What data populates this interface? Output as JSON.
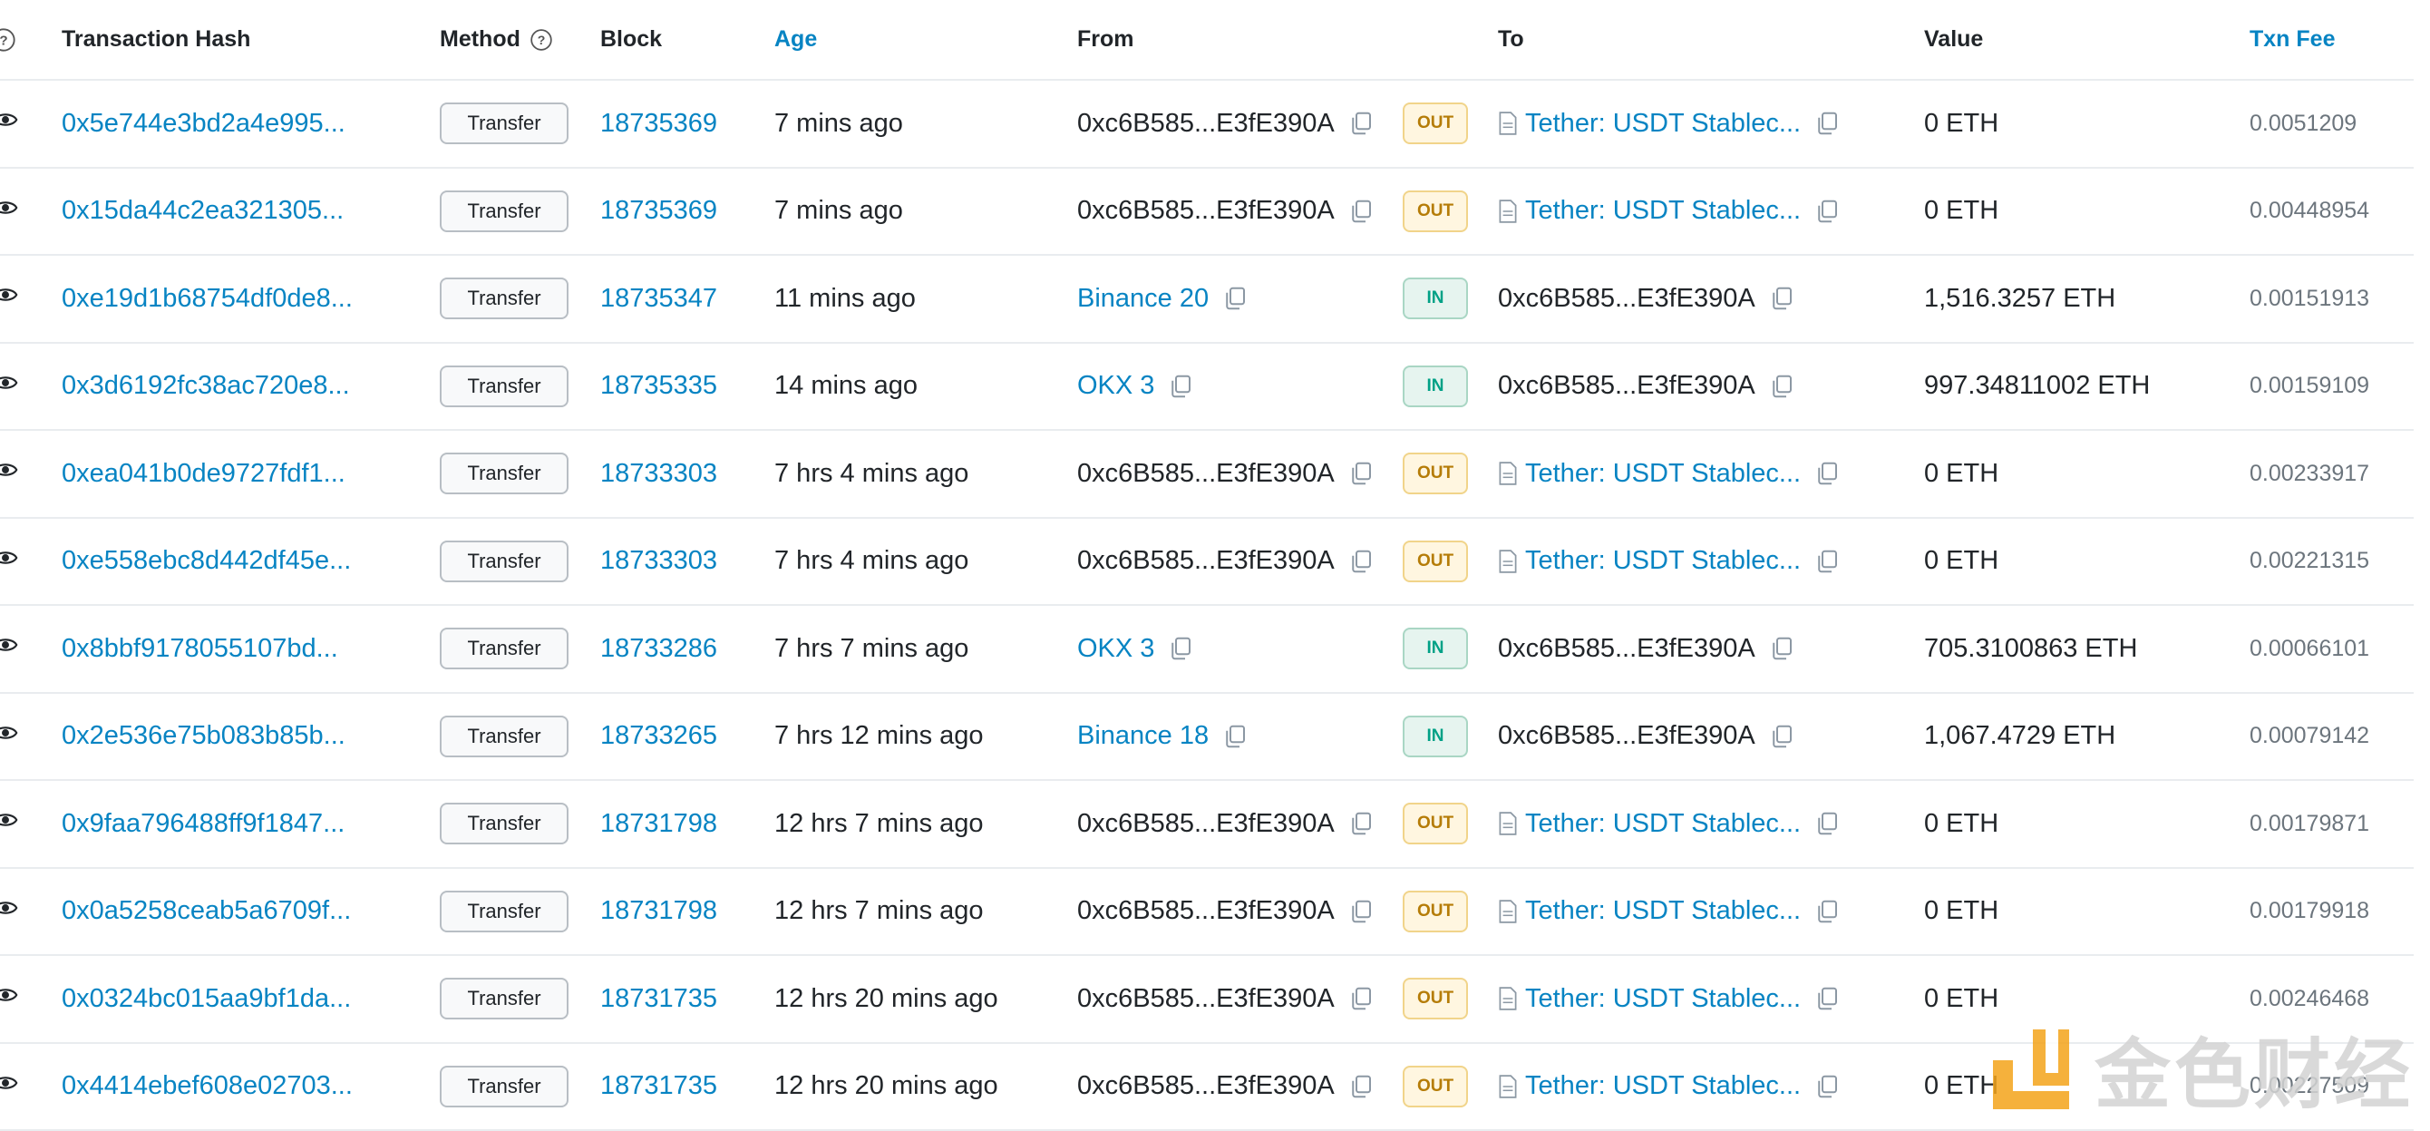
{
  "headers": {
    "hash": "Transaction Hash",
    "method": "Method",
    "block": "Block",
    "age": "Age",
    "from": "From",
    "to": "To",
    "value": "Value",
    "fee": "Txn Fee"
  },
  "colors": {
    "link": "#0784c3",
    "out_bg": "#fff6e0",
    "out_text": "#b57c07",
    "in_bg": "#e6f4ef",
    "in_text": "#00a186"
  },
  "rows": [
    {
      "hash": "0x5e744e3bd2a4e995...",
      "method": "Transfer",
      "block": "18735369",
      "age": "7 mins ago",
      "from": "0xc6B585...E3fE390A",
      "from_is_link": false,
      "direction": "OUT",
      "to": "Tether: USDT Stablec...",
      "to_is_contract": true,
      "value": "0 ETH",
      "fee": "0.0051209"
    },
    {
      "hash": "0x15da44c2ea321305...",
      "method": "Transfer",
      "block": "18735369",
      "age": "7 mins ago",
      "from": "0xc6B585...E3fE390A",
      "from_is_link": false,
      "direction": "OUT",
      "to": "Tether: USDT Stablec...",
      "to_is_contract": true,
      "value": "0 ETH",
      "fee": "0.00448954"
    },
    {
      "hash": "0xe19d1b68754df0de8...",
      "method": "Transfer",
      "block": "18735347",
      "age": "11 mins ago",
      "from": "Binance 20",
      "from_is_link": true,
      "direction": "IN",
      "to": "0xc6B585...E3fE390A",
      "to_is_contract": false,
      "value": "1,516.3257 ETH",
      "fee": "0.00151913"
    },
    {
      "hash": "0x3d6192fc38ac720e8...",
      "method": "Transfer",
      "block": "18735335",
      "age": "14 mins ago",
      "from": "OKX 3",
      "from_is_link": true,
      "direction": "IN",
      "to": "0xc6B585...E3fE390A",
      "to_is_contract": false,
      "value": "997.34811002 ETH",
      "fee": "0.00159109"
    },
    {
      "hash": "0xea041b0de9727fdf1...",
      "method": "Transfer",
      "block": "18733303",
      "age": "7 hrs 4 mins ago",
      "from": "0xc6B585...E3fE390A",
      "from_is_link": false,
      "direction": "OUT",
      "to": "Tether: USDT Stablec...",
      "to_is_contract": true,
      "value": "0 ETH",
      "fee": "0.00233917"
    },
    {
      "hash": "0xe558ebc8d442df45e...",
      "method": "Transfer",
      "block": "18733303",
      "age": "7 hrs 4 mins ago",
      "from": "0xc6B585...E3fE390A",
      "from_is_link": false,
      "direction": "OUT",
      "to": "Tether: USDT Stablec...",
      "to_is_contract": true,
      "value": "0 ETH",
      "fee": "0.00221315"
    },
    {
      "hash": "0x8bbf9178055107bd...",
      "method": "Transfer",
      "block": "18733286",
      "age": "7 hrs 7 mins ago",
      "from": "OKX 3",
      "from_is_link": true,
      "direction": "IN",
      "to": "0xc6B585...E3fE390A",
      "to_is_contract": false,
      "value": "705.3100863 ETH",
      "fee": "0.00066101"
    },
    {
      "hash": "0x2e536e75b083b85b...",
      "method": "Transfer",
      "block": "18733265",
      "age": "7 hrs 12 mins ago",
      "from": "Binance 18",
      "from_is_link": true,
      "direction": "IN",
      "to": "0xc6B585...E3fE390A",
      "to_is_contract": false,
      "value": "1,067.4729 ETH",
      "fee": "0.00079142"
    },
    {
      "hash": "0x9faa796488ff9f1847...",
      "method": "Transfer",
      "block": "18731798",
      "age": "12 hrs 7 mins ago",
      "from": "0xc6B585...E3fE390A",
      "from_is_link": false,
      "direction": "OUT",
      "to": "Tether: USDT Stablec...",
      "to_is_contract": true,
      "value": "0 ETH",
      "fee": "0.00179871"
    },
    {
      "hash": "0x0a5258ceab5a6709f...",
      "method": "Transfer",
      "block": "18731798",
      "age": "12 hrs 7 mins ago",
      "from": "0xc6B585...E3fE390A",
      "from_is_link": false,
      "direction": "OUT",
      "to": "Tether: USDT Stablec...",
      "to_is_contract": true,
      "value": "0 ETH",
      "fee": "0.00179918"
    },
    {
      "hash": "0x0324bc015aa9bf1da...",
      "method": "Transfer",
      "block": "18731735",
      "age": "12 hrs 20 mins ago",
      "from": "0xc6B585...E3fE390A",
      "from_is_link": false,
      "direction": "OUT",
      "to": "Tether: USDT Stablec...",
      "to_is_contract": true,
      "value": "0 ETH",
      "fee": "0.00246468"
    },
    {
      "hash": "0x4414ebef608e02703...",
      "method": "Transfer",
      "block": "18731735",
      "age": "12 hrs 20 mins ago",
      "from": "0xc6B585...E3fE390A",
      "from_is_link": false,
      "direction": "OUT",
      "to": "Tether: USDT Stablec...",
      "to_is_contract": true,
      "value": "0 ETH",
      "fee": "0.00227509"
    }
  ],
  "watermark": {
    "text": "金色财经",
    "icon": "jinse-logo"
  }
}
